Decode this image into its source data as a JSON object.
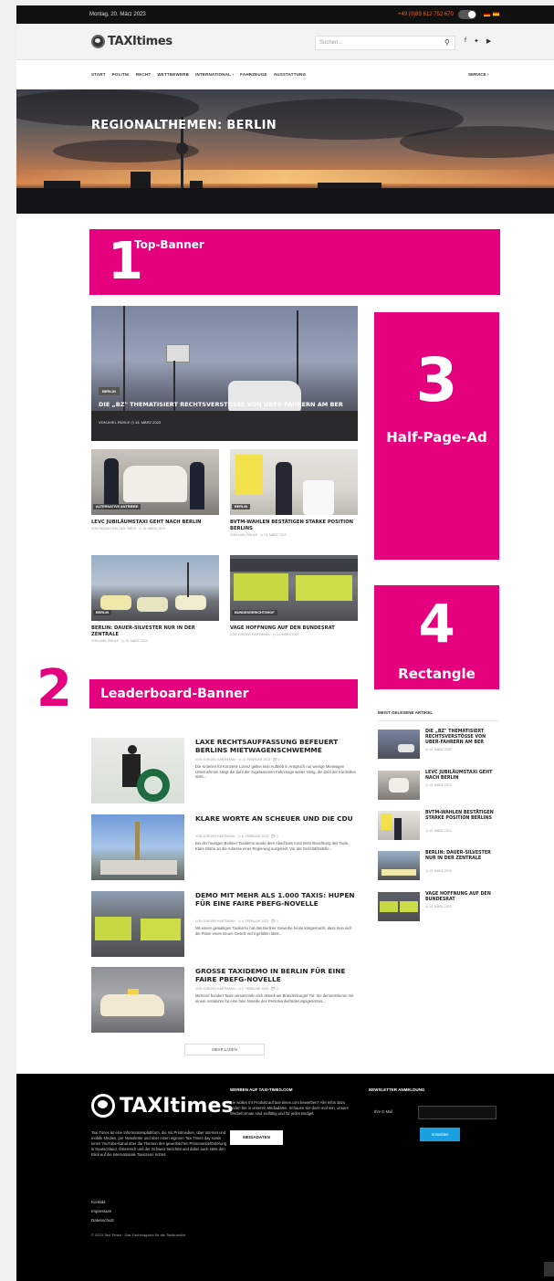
{
  "topbar": {
    "date": "Montag, 20. März 2023",
    "phone": "+49 (0)89 612 752 670",
    "flag_colors": [
      "#000000",
      "#dd0000",
      "#ffce00"
    ]
  },
  "header": {
    "logo_text": "TAXItimes",
    "search_placeholder": "Suchen...",
    "social_icons": [
      "facebook-icon",
      "twitter-icon",
      "youtube-icon"
    ]
  },
  "nav": {
    "items": [
      "START",
      "POLITIK",
      "RECHT",
      "WETTBEWERB",
      "INTERNATIONAL ›",
      "FAHRZEUGE",
      "AUSSTATTUNG"
    ],
    "service": "SERVICE ›"
  },
  "hero": {
    "title": "REGIONALTHEMEN: BERLIN"
  },
  "ads": {
    "top_banner": {
      "num": "1",
      "label": "Top-Banner"
    },
    "leaderboard": {
      "num": "2",
      "label": "Leaderboard-Banner"
    },
    "half_page": {
      "num": "3",
      "label": "Half-Page-Ad"
    },
    "rectangle": {
      "num": "4",
      "label": "Rectangle"
    },
    "color": "#e5007e"
  },
  "feature": {
    "tag": "BERLIN",
    "title": "DIE „BZ\" THEMATISIERT RECHTSVERSTÖSSE VON UBER-FAHRERN AM BER",
    "meta": "VON AXEL RÜHLE  ◷ 15. MÄRZ 2023"
  },
  "cards": [
    {
      "tag": "ALTERNATIVE ANTRIEBE",
      "title": "LEVC JUBILÄUMSTAXI GEHT NACH BERLIN",
      "meta": "VON REDAKTION TAXI TIMES · ◷ 15. MÄRZ 2023"
    },
    {
      "tag": "BERLIN",
      "title": "BVTM-WAHLEN BESTÄTIGEN STARKE POSITION BERLINS",
      "meta": "VON AXEL RÜHLE · ◷ 13. MÄRZ 2023"
    },
    {
      "tag": "BERLIN",
      "title": "BERLIN: DAUER-SILVESTER NUR IN DER ZENTRALE",
      "meta": "VON AXEL RÜHLE · ◷ 13. MÄRZ 2023"
    },
    {
      "tag": "BUNDESGERICHTSHOF",
      "title": "VAGE HOFFNUNG AUF DEN BUNDESRAT",
      "meta": "VON JÜRGEN HARTMANN · ◷ 14. MÄRZ 2023"
    }
  ],
  "list": [
    {
      "title": "LAXE RECHTSAUFFASSUNG BEFEUERT BERLINS MIETWAGENSCHWEMME",
      "meta": "VON JÜRGEN HARTMANN · ◷ 10. FEBRUAR 2023 · 💬 0",
      "excerpt": "Die Kriterien für Konzerte Lizenz gelten kein Auftrieb in Anspruch nur wenige Mietwagen Unternehmen steigt die Zahl der zugelassenen Fahrzeuge weiter stetig, die Zahl der Kontrollen sinkt..."
    },
    {
      "title": "KLARE WORTE AN SCHEUER UND DIE CDU",
      "meta": "VON JÜRGEN HARTMANN · ◷ 8. FEBRUAR 2023 · 💬 0",
      "excerpt": "Bei der heutigen Berliner Taxidemo wurde dem Abschluss rund mehr Beachtung des Taxis. Klare Worte an die Adresse einer Regierung ausgeteilt. Vor der Geschäftsstelle..."
    },
    {
      "title": "DEMO MIT MEHR ALS 1.000 TAXIS: HUPEN FÜR EINE FAIRE PBEFG-NOVELLE",
      "meta": "VON JÜRGEN HARTMANN · ◷ 4. FEBRUAR 2023 · 💬 0",
      "excerpt": "Mit einem gewaltigen Taxikorso hat das Berliner Gewerbe heute klargemacht, dass man sich die Pläne eines neuen Gesetz nicht gefallen lässt..."
    },
    {
      "title": "GROSSE TAXIDEMO IN BERLIN FÜR EINE FAIRE PBEFG-NOVELLE",
      "meta": "VON JÜRGEN HARTMANN · ◷ 2. FEBRUAR 2023 · 💬 0",
      "excerpt": "Mehrere hundert Taxis versammeln sich aktuell am Brandenburger Tor. Sie demonstrieren mit einem Autokorso für eine faire Novelle des Personenbeförderungsgesetzes..."
    }
  ],
  "more_button": "MEHR LADEN",
  "sidebar": {
    "title": "MEIST GELESENE ARTIKEL",
    "items": [
      {
        "title": "DIE „BZ\" THEMATISIERT RECHTSVERSTÖSSE VON UBER-FAHRERN AM BER",
        "date": "◷ 15. MÄRZ 2023"
      },
      {
        "title": "LEVC JUBILÄUMSTAXI GEHT NACH BERLIN",
        "date": "◷ 15. MÄRZ 2023"
      },
      {
        "title": "BVTM-WAHLEN BESTÄTIGEN STARKE POSITION BERLINS",
        "date": "◷ 13. MÄRZ 2023"
      },
      {
        "title": "BERLIN: DAUER-SILVESTER NUR IN DER ZENTRALE",
        "date": "◷ 13. MÄRZ 2023"
      },
      {
        "title": "VAGE HOFFNUNG AUF DEN BUNDESRAT",
        "date": "◷ 14. MÄRZ 2023"
      }
    ]
  },
  "footer": {
    "logo_text": "TAXItimes",
    "about": "Taxi Times ist eine Informationsplattform, die mit Printmedien, über Internet und mobile Medien, per Newsletter und über einen eigenen Taxi Times day sowie einen YouTube-Kanal über die Themen des gewerblichen Personenbeförderung in Deutschland, Österreich und der Schweiz berichtet und dabei auch stets den Blick auf die internationale Taxiszene richtet.",
    "links": [
      "Kontakt",
      "Impressum",
      "Datenschutz"
    ],
    "copyright": "© 2023 Taxi Times · Das Fachmagazin für die Taxibranche",
    "col2_title": "WERBEN AUF TAXI-TIMES.COM",
    "col2_text": "Sie wollen Ihr Produkt auf taxi-times.com bewerben? Alle Infos dazu finden Sie in unseren Mediadaten. Schauen Sie doch mal rein, unsere Werbeformate sind vielfältig und für jedes Budget.",
    "media_button": "MEDIADATEN",
    "col3_title": "NEWSLETTER ANMELDUNG",
    "email_label": "Ihre E-Mail",
    "subscribe": "Anmelden"
  }
}
